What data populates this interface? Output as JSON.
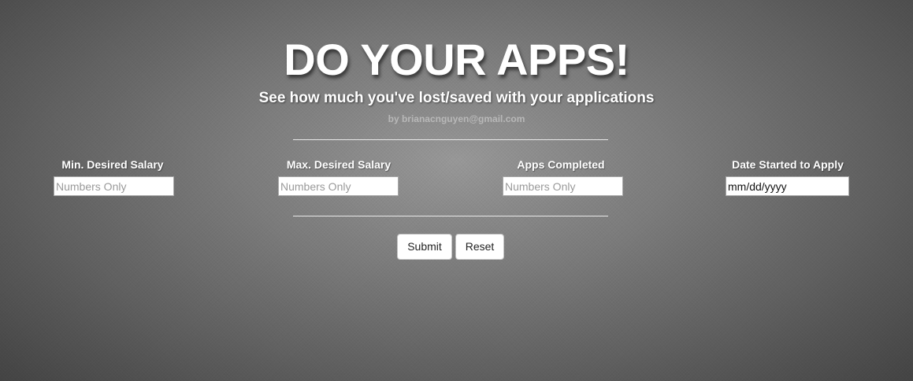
{
  "header": {
    "title": "DO YOUR APPS!",
    "subtitle": "See how much you've lost/saved with your applications",
    "byline": "by brianacnguyen@gmail.com"
  },
  "form": {
    "fields": [
      {
        "label": "Min. Desired Salary",
        "placeholder": "Numbers Only",
        "value": ""
      },
      {
        "label": "Max. Desired Salary",
        "placeholder": "Numbers Only",
        "value": ""
      },
      {
        "label": "Apps Completed",
        "placeholder": "Numbers Only",
        "value": ""
      },
      {
        "label": "Date Started to Apply",
        "placeholder": "mm/dd/yyyy",
        "value": "mm/dd/yyyy"
      }
    ],
    "submit_label": "Submit",
    "reset_label": "Reset"
  },
  "colors": {
    "background_center": "#9a9a9a",
    "background_edge": "#444444",
    "text": "#ffffff",
    "byline": "#b8b8b8"
  }
}
